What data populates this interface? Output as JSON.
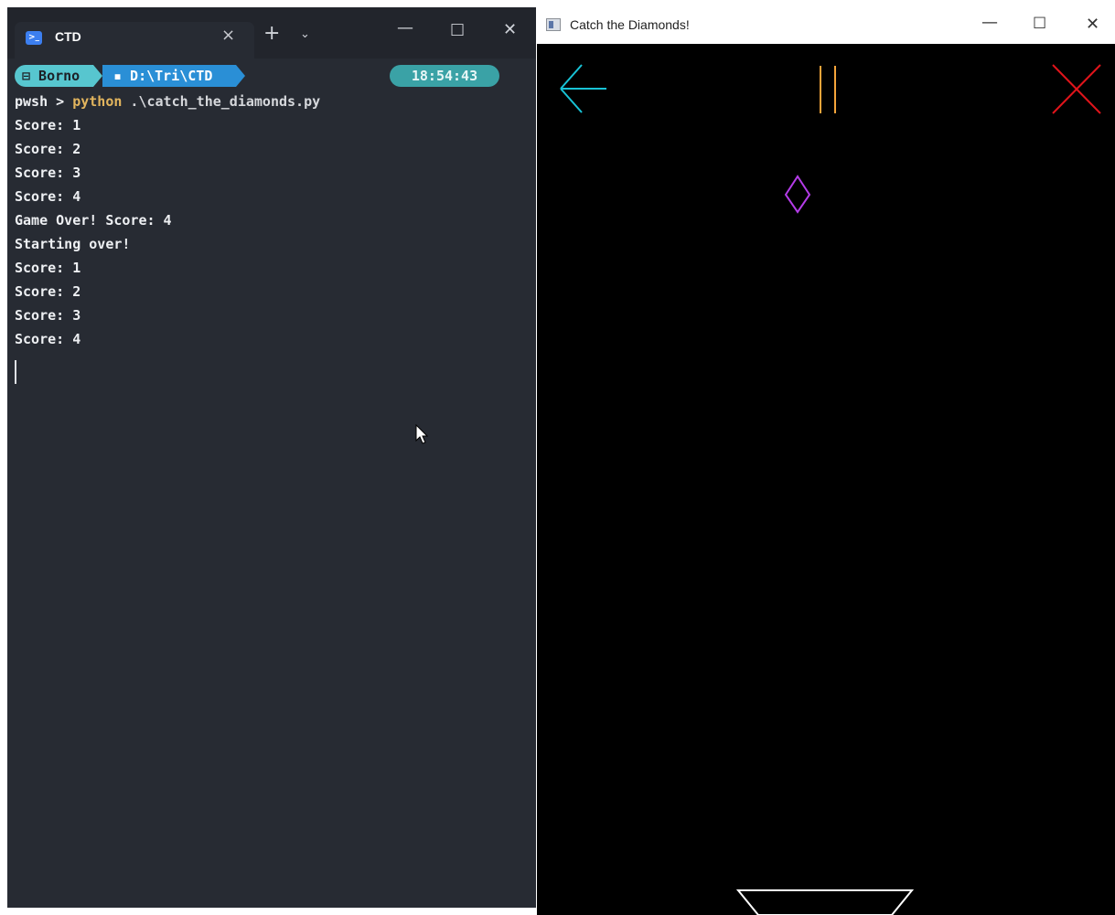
{
  "terminal": {
    "tab_title": "CTD",
    "tab_close": "×",
    "new_tab": "+",
    "tab_dropdown": "⌄",
    "controls": {
      "minimize": "—",
      "maximize": "□",
      "close": "✕"
    },
    "prompt": {
      "user": "⊟ Borno",
      "path": "▪ D:\\Tri\\CTD",
      "time": "18:54:43"
    },
    "command": {
      "shell": "pwsh > ",
      "program": "python",
      "args": " .\\catch_the_diamonds.py"
    },
    "output": [
      "Score: 1",
      "Score: 2",
      "Score: 3",
      "Score: 4",
      "Game Over! Score: 4",
      "Starting over!",
      "Score: 1",
      "Score: 2",
      "Score: 3",
      "Score: 4"
    ]
  },
  "game": {
    "title": "Catch the Diamonds!",
    "controls": {
      "minimize": "—",
      "maximize": "☐",
      "close": "✕"
    },
    "colors": {
      "background": "#000000",
      "back_arrow": "#18c3d6",
      "pause": "#f5a43a",
      "exit": "#e0141b",
      "diamond": "#b43ce8",
      "catcher": "#ffffff"
    },
    "icons": {
      "back": "left-arrow-icon",
      "pause": "pause-icon",
      "exit": "close-x-icon",
      "diamond": "diamond",
      "catcher": "catcher-bowl"
    }
  }
}
